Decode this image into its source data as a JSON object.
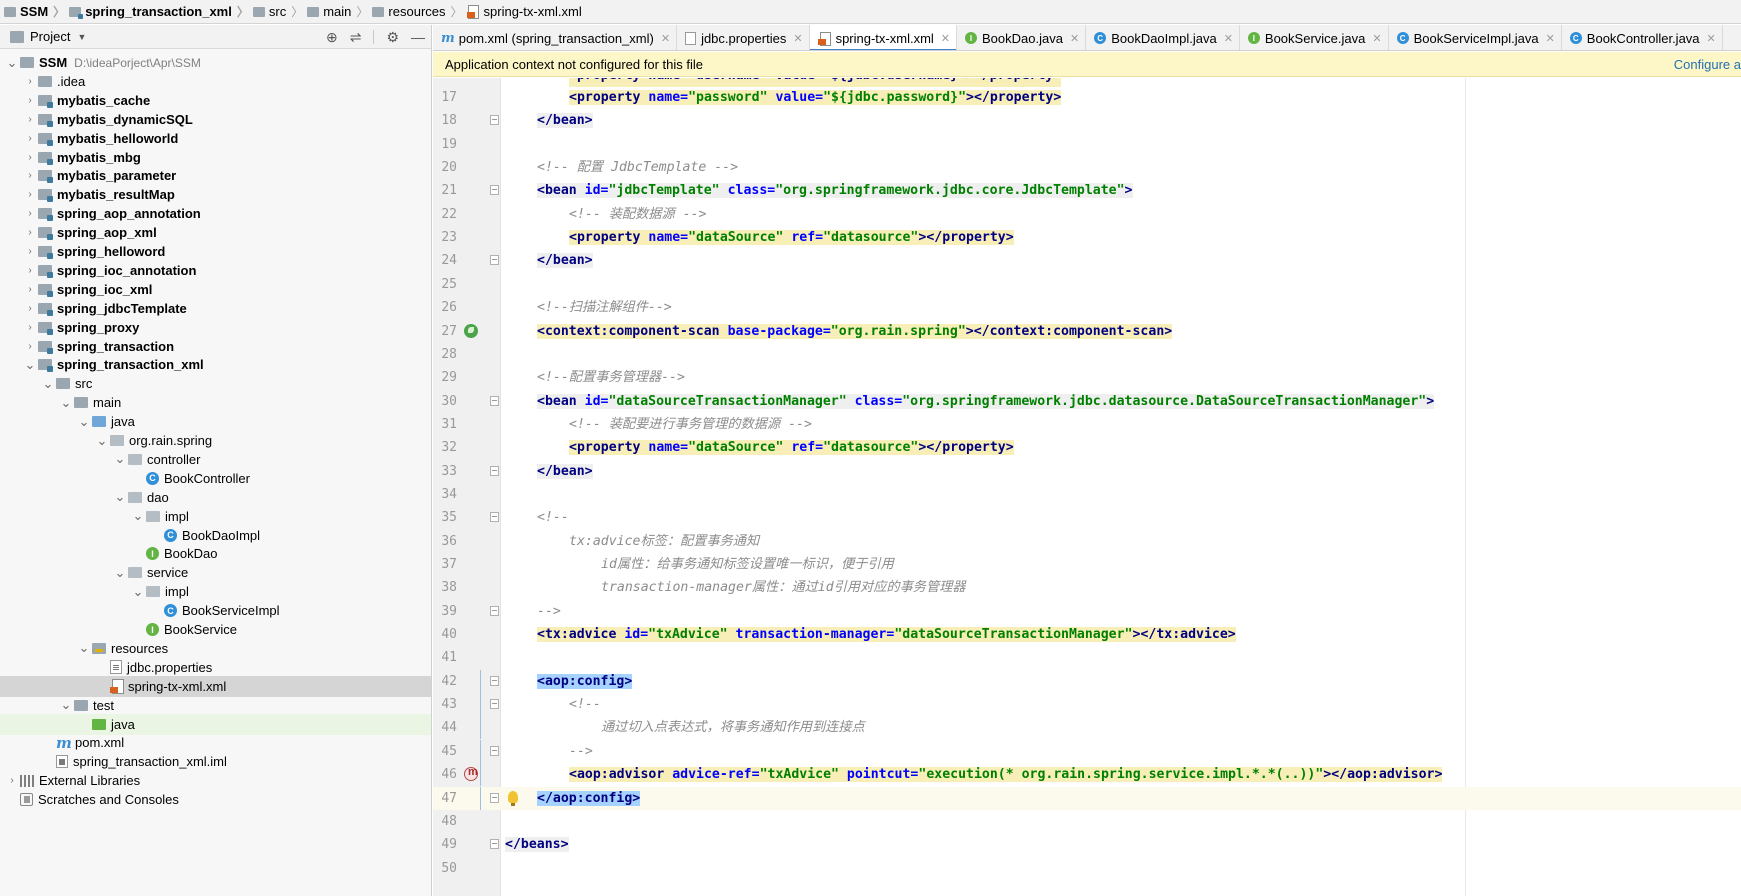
{
  "breadcrumb": [
    {
      "label": "SSM",
      "bold": true
    },
    {
      "label": "spring_transaction_xml",
      "bold": true
    },
    {
      "label": "src"
    },
    {
      "label": "main"
    },
    {
      "label": "resources"
    },
    {
      "label": "spring-tx-xml.xml"
    }
  ],
  "project": {
    "title": "Project",
    "root_path": "D:\\ideaPorject\\Apr\\SSM"
  },
  "tree": [
    {
      "label": "SSM",
      "depth": 0,
      "arrow": "down",
      "icon": "folder-icon",
      "bold": true,
      "path": "D:\\ideaPorject\\Apr\\SSM"
    },
    {
      "label": ".idea",
      "depth": 1,
      "arrow": "right",
      "icon": "folder-icon"
    },
    {
      "label": "mybatis_cache",
      "depth": 1,
      "arrow": "right",
      "icon": "module-folder-icon",
      "bold": true
    },
    {
      "label": "mybatis_dynamicSQL",
      "depth": 1,
      "arrow": "right",
      "icon": "module-folder-icon",
      "bold": true
    },
    {
      "label": "mybatis_helloworld",
      "depth": 1,
      "arrow": "right",
      "icon": "module-folder-icon",
      "bold": true
    },
    {
      "label": "mybatis_mbg",
      "depth": 1,
      "arrow": "right",
      "icon": "module-folder-icon",
      "bold": true
    },
    {
      "label": "mybatis_parameter",
      "depth": 1,
      "arrow": "right",
      "icon": "module-folder-icon",
      "bold": true
    },
    {
      "label": "mybatis_resultMap",
      "depth": 1,
      "arrow": "right",
      "icon": "module-folder-icon",
      "bold": true
    },
    {
      "label": "spring_aop_annotation",
      "depth": 1,
      "arrow": "right",
      "icon": "module-folder-icon",
      "bold": true
    },
    {
      "label": "spring_aop_xml",
      "depth": 1,
      "arrow": "right",
      "icon": "module-folder-icon",
      "bold": true
    },
    {
      "label": "spring_helloword",
      "depth": 1,
      "arrow": "right",
      "icon": "module-folder-icon",
      "bold": true
    },
    {
      "label": "spring_ioc_annotation",
      "depth": 1,
      "arrow": "right",
      "icon": "module-folder-icon",
      "bold": true
    },
    {
      "label": "spring_ioc_xml",
      "depth": 1,
      "arrow": "right",
      "icon": "module-folder-icon",
      "bold": true
    },
    {
      "label": "spring_jdbcTemplate",
      "depth": 1,
      "arrow": "right",
      "icon": "module-folder-icon",
      "bold": true
    },
    {
      "label": "spring_proxy",
      "depth": 1,
      "arrow": "right",
      "icon": "module-folder-icon",
      "bold": true
    },
    {
      "label": "spring_transaction",
      "depth": 1,
      "arrow": "right",
      "icon": "module-folder-icon",
      "bold": true
    },
    {
      "label": "spring_transaction_xml",
      "depth": 1,
      "arrow": "down",
      "icon": "module-folder-icon",
      "bold": true
    },
    {
      "label": "src",
      "depth": 2,
      "arrow": "down",
      "icon": "folder-icon"
    },
    {
      "label": "main",
      "depth": 3,
      "arrow": "down",
      "icon": "folder-icon"
    },
    {
      "label": "java",
      "depth": 4,
      "arrow": "down",
      "icon": "source-folder-icon"
    },
    {
      "label": "org.rain.spring",
      "depth": 5,
      "arrow": "down",
      "icon": "package-icon"
    },
    {
      "label": "controller",
      "depth": 6,
      "arrow": "down",
      "icon": "package-icon"
    },
    {
      "label": "BookController",
      "depth": 7,
      "arrow": "none",
      "icon": "class-icon"
    },
    {
      "label": "dao",
      "depth": 6,
      "arrow": "down",
      "icon": "package-icon"
    },
    {
      "label": "impl",
      "depth": 7,
      "arrow": "down",
      "icon": "package-icon"
    },
    {
      "label": "BookDaoImpl",
      "depth": 8,
      "arrow": "none",
      "icon": "class-icon"
    },
    {
      "label": "BookDao",
      "depth": 7,
      "arrow": "none",
      "icon": "interface-icon"
    },
    {
      "label": "service",
      "depth": 6,
      "arrow": "down",
      "icon": "package-icon"
    },
    {
      "label": "impl",
      "depth": 7,
      "arrow": "down",
      "icon": "package-icon"
    },
    {
      "label": "BookServiceImpl",
      "depth": 8,
      "arrow": "none",
      "icon": "class-icon"
    },
    {
      "label": "BookService",
      "depth": 7,
      "arrow": "none",
      "icon": "interface-icon"
    },
    {
      "label": "resources",
      "depth": 4,
      "arrow": "down",
      "icon": "resources-folder-icon"
    },
    {
      "label": "jdbc.properties",
      "depth": 5,
      "arrow": "none",
      "icon": "properties-file-icon"
    },
    {
      "label": "spring-tx-xml.xml",
      "depth": 5,
      "arrow": "none",
      "icon": "xml-file-icon",
      "selected": true
    },
    {
      "label": "test",
      "depth": 3,
      "arrow": "down",
      "icon": "folder-icon"
    },
    {
      "label": "java",
      "depth": 4,
      "arrow": "none",
      "icon": "test-folder-icon",
      "green": true
    },
    {
      "label": "pom.xml",
      "depth": 2,
      "arrow": "none",
      "icon": "maven-icon"
    },
    {
      "label": "spring_transaction_xml.iml",
      "depth": 2,
      "arrow": "none",
      "icon": "iml-file-icon"
    },
    {
      "label": "External Libraries",
      "depth": 0,
      "arrow": "right",
      "icon": "libraries-icon"
    },
    {
      "label": "Scratches and Consoles",
      "depth": 0,
      "arrow": "none",
      "icon": "scratches-icon"
    }
  ],
  "tabs": [
    {
      "label": "pom.xml (spring_transaction_xml)",
      "icon": "maven-icon"
    },
    {
      "label": "jdbc.properties",
      "icon": "properties-file-icon"
    },
    {
      "label": "spring-tx-xml.xml",
      "icon": "xml-file-icon",
      "active": true
    },
    {
      "label": "BookDao.java",
      "icon": "interface-icon"
    },
    {
      "label": "BookDaoImpl.java",
      "icon": "class-icon"
    },
    {
      "label": "BookService.java",
      "icon": "interface-icon"
    },
    {
      "label": "BookServiceImpl.java",
      "icon": "class-icon"
    },
    {
      "label": "BookController.java",
      "icon": "class-icon"
    }
  ],
  "notification": {
    "message": "Application context not configured for this file",
    "action": "Configure a"
  },
  "editor": {
    "partial_line": "<property name=\"username\" value=\"${jdbc.username}\"></property>",
    "lines": [
      {
        "num": "17",
        "kind": "prop",
        "html_key": "l17"
      },
      {
        "num": "18"
      },
      {
        "num": "19"
      },
      {
        "num": "20"
      },
      {
        "num": "21"
      },
      {
        "num": "22"
      },
      {
        "num": "23"
      },
      {
        "num": "24"
      },
      {
        "num": "25"
      },
      {
        "num": "26"
      },
      {
        "num": "27"
      },
      {
        "num": "28"
      },
      {
        "num": "29"
      },
      {
        "num": "30"
      },
      {
        "num": "31"
      },
      {
        "num": "32"
      },
      {
        "num": "33"
      },
      {
        "num": "34"
      },
      {
        "num": "35"
      },
      {
        "num": "36"
      },
      {
        "num": "37"
      },
      {
        "num": "38"
      },
      {
        "num": "39"
      },
      {
        "num": "40"
      },
      {
        "num": "41"
      },
      {
        "num": "42"
      },
      {
        "num": "43"
      },
      {
        "num": "44"
      },
      {
        "num": "45"
      },
      {
        "num": "46"
      },
      {
        "num": "47"
      },
      {
        "num": "48"
      },
      {
        "num": "49"
      },
      {
        "num": "50"
      }
    ],
    "code": {
      "l17": [
        "<property ",
        "name=",
        "\"password\"",
        " value=",
        "\"${jdbc.password}\"",
        "></property>"
      ],
      "l18": "</bean>",
      "l20": "<!-- 配置 JdbcTemplate -->",
      "l21": [
        "<bean ",
        "id=",
        "\"jdbcTemplate\"",
        " class=",
        "\"org.springframework.jdbc.core.JdbcTemplate\"",
        ">"
      ],
      "l22": "<!-- 装配数据源 -->",
      "l23": [
        "<property ",
        "name=",
        "\"dataSource\"",
        " ref=",
        "\"datasource\"",
        "></property>"
      ],
      "l24": "</bean>",
      "l26": "<!--扫描注解组件-->",
      "l27": [
        "<context:component-scan ",
        "base-package=",
        "\"org.rain.spring\"",
        "></context:component-scan>"
      ],
      "l29": "<!--配置事务管理器-->",
      "l30": [
        "<bean ",
        "id=",
        "\"dataSourceTransactionManager\"",
        " class=",
        "\"org.springframework.jdbc.datasource.DataSourceTransactionManager\"",
        ">"
      ],
      "l31": "<!-- 装配要进行事务管理的数据源 -->",
      "l32": [
        "<property ",
        "name=",
        "\"dataSource\"",
        " ref=",
        "\"datasource\"",
        "></property>"
      ],
      "l33": "</bean>",
      "l35": "<!--",
      "l36": "tx:advice标签：配置事务通知",
      "l37": "id属性：给事务通知标签设置唯一标识，便于引用",
      "l38": "transaction-manager属性：通过id引用对应的事务管理器",
      "l39": "-->",
      "l40": [
        "<tx:advice ",
        "id=",
        "\"txAdvice\"",
        " transaction-manager=",
        "\"dataSourceTransactionManager\"",
        "></tx:advice>"
      ],
      "l42": "<aop:config>",
      "l43": "<!--",
      "l44": "通过切入点表达式，将事务通知作用到连接点",
      "l45": "-->",
      "l46": [
        "<aop:advisor ",
        "advice-ref=",
        "\"txAdvice\"",
        " pointcut=",
        "\"execution(* org.rain.spring.service.impl.*.*(..))\"",
        "></aop:advisor>"
      ],
      "l47": "</aop:config>",
      "l49": "</beans>"
    }
  }
}
